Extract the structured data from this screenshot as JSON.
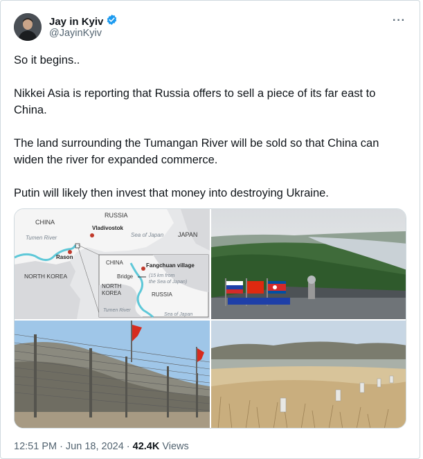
{
  "author": {
    "name": "Jay in Kyiv",
    "handle": "@JayinKyiv",
    "verified": true
  },
  "tweet": {
    "paragraphs": [
      "So it begins..",
      "Nikkei Asia is reporting that Russia offers to sell a piece of its far east to China.",
      "The land surrounding the Tumangan River will be sold so that China can widen the river for expanded commerce.",
      "Putin will likely then invest that money into destroying Ukraine."
    ]
  },
  "map": {
    "russia": "RUSSIA",
    "china": "CHINA",
    "vladivostok": "Vladivostok",
    "sea_of_japan": "Sea of Japan",
    "japan": "JAPAN",
    "tumen_river": "Tumen River",
    "rason": "Rason",
    "north_korea": "NORTH KOREA",
    "inset": {
      "china": "CHINA",
      "village": "Fangchuan village",
      "bridge": "Bridge",
      "note_line1": "(15 km from",
      "note_line2": "the Sea of Japan)",
      "north": "NORTH",
      "korea": "KOREA",
      "russia": "RUSSIA",
      "tumen_river": "Tumen River",
      "sea_of_japan": "Sea of Japan"
    }
  },
  "footer": {
    "time": "12:51 PM",
    "sep1": "·",
    "date": "Jun 18, 2024",
    "sep2": "·",
    "views": "42.4K",
    "views_label": "Views"
  },
  "colors": {
    "verified": "#1d9bf0",
    "secondary_text": "#536471",
    "border": "#cfd9de",
    "river": "#5ec8d8",
    "map_red": "#c0392b"
  },
  "icons": [
    "verified-badge-icon",
    "more-options-icon"
  ]
}
